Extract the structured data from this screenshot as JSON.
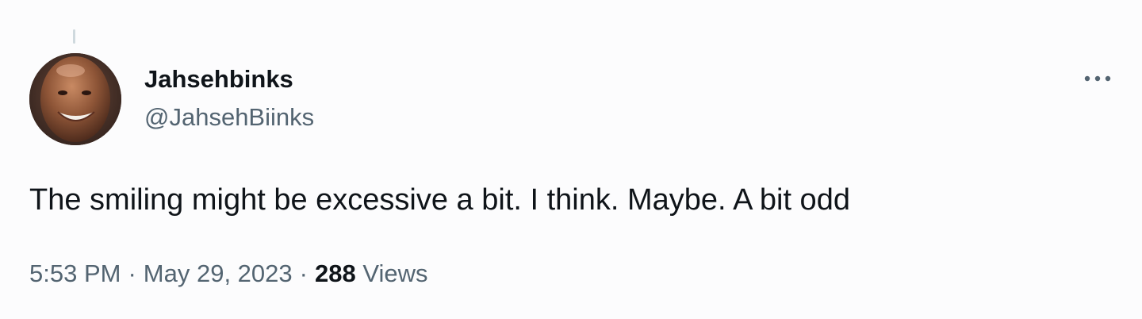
{
  "author": {
    "display_name": "Jahsehbinks",
    "handle": "@JahsehBiinks"
  },
  "tweet": {
    "text": "The smiling might be excessive a bit. I think. Maybe. A bit odd"
  },
  "meta": {
    "time": "5:53 PM",
    "date": "May 29, 2023",
    "separator": "·",
    "views_count": "288",
    "views_label": "Views"
  },
  "icons": {
    "more": "more-horizontal-icon"
  },
  "colors": {
    "primary_text": "#0f1419",
    "secondary_text": "#536471",
    "background": "#fcfcfd",
    "thread_line": "#cfd9de"
  }
}
